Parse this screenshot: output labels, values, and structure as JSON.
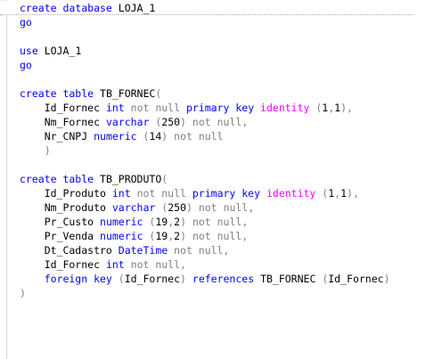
{
  "editor": {
    "lines": [
      [
        {
          "t": "create database ",
          "c": "kw"
        },
        {
          "t": "LOJA_1",
          "c": "tx"
        }
      ],
      [
        {
          "t": "go",
          "c": "kw"
        }
      ],
      [],
      [
        {
          "t": "use ",
          "c": "kw"
        },
        {
          "t": "LOJA_1",
          "c": "tx"
        }
      ],
      [
        {
          "t": "go",
          "c": "kw"
        }
      ],
      [],
      [
        {
          "t": "create table ",
          "c": "kw"
        },
        {
          "t": "TB_FORNEC",
          "c": "tx"
        },
        {
          "t": "(",
          "c": "gr"
        }
      ],
      [
        {
          "t": "    Id_Fornec ",
          "c": "tx"
        },
        {
          "t": "int ",
          "c": "kw"
        },
        {
          "t": "not null ",
          "c": "gr"
        },
        {
          "t": "primary key ",
          "c": "kw"
        },
        {
          "t": "identity ",
          "c": "pk"
        },
        {
          "t": "(",
          "c": "gr"
        },
        {
          "t": "1",
          "c": "tx"
        },
        {
          "t": ",",
          "c": "gr"
        },
        {
          "t": "1",
          "c": "tx"
        },
        {
          "t": "),",
          "c": "gr"
        }
      ],
      [
        {
          "t": "    Nm_Fornec ",
          "c": "tx"
        },
        {
          "t": "varchar ",
          "c": "kw"
        },
        {
          "t": "(",
          "c": "gr"
        },
        {
          "t": "250",
          "c": "tx"
        },
        {
          "t": ") ",
          "c": "gr"
        },
        {
          "t": "not null,",
          "c": "gr"
        }
      ],
      [
        {
          "t": "    Nr_CNPJ ",
          "c": "tx"
        },
        {
          "t": "numeric ",
          "c": "kw"
        },
        {
          "t": "(",
          "c": "gr"
        },
        {
          "t": "14",
          "c": "tx"
        },
        {
          "t": ") ",
          "c": "gr"
        },
        {
          "t": "not null",
          "c": "gr"
        }
      ],
      [
        {
          "t": "    )",
          "c": "gr"
        }
      ],
      [],
      [
        {
          "t": "create table ",
          "c": "kw"
        },
        {
          "t": "TB_PRODUTO",
          "c": "tx"
        },
        {
          "t": "(",
          "c": "gr"
        }
      ],
      [
        {
          "t": "    Id_Produto ",
          "c": "tx"
        },
        {
          "t": "int ",
          "c": "kw"
        },
        {
          "t": "not null ",
          "c": "gr"
        },
        {
          "t": "primary key ",
          "c": "kw"
        },
        {
          "t": "identity ",
          "c": "pk"
        },
        {
          "t": "(",
          "c": "gr"
        },
        {
          "t": "1",
          "c": "tx"
        },
        {
          "t": ",",
          "c": "gr"
        },
        {
          "t": "1",
          "c": "tx"
        },
        {
          "t": "),",
          "c": "gr"
        }
      ],
      [
        {
          "t": "    Nm_Produto ",
          "c": "tx"
        },
        {
          "t": "varchar ",
          "c": "kw"
        },
        {
          "t": "(",
          "c": "gr"
        },
        {
          "t": "250",
          "c": "tx"
        },
        {
          "t": ") ",
          "c": "gr"
        },
        {
          "t": "not null,",
          "c": "gr"
        }
      ],
      [
        {
          "t": "    Pr_Custo ",
          "c": "tx"
        },
        {
          "t": "numeric ",
          "c": "kw"
        },
        {
          "t": "(",
          "c": "gr"
        },
        {
          "t": "19",
          "c": "tx"
        },
        {
          "t": ",",
          "c": "gr"
        },
        {
          "t": "2",
          "c": "tx"
        },
        {
          "t": ") ",
          "c": "gr"
        },
        {
          "t": "not null,",
          "c": "gr"
        }
      ],
      [
        {
          "t": "    Pr_Venda ",
          "c": "tx"
        },
        {
          "t": "numeric ",
          "c": "kw"
        },
        {
          "t": "(",
          "c": "gr"
        },
        {
          "t": "19",
          "c": "tx"
        },
        {
          "t": ",",
          "c": "gr"
        },
        {
          "t": "2",
          "c": "tx"
        },
        {
          "t": ") ",
          "c": "gr"
        },
        {
          "t": "not null,",
          "c": "gr"
        }
      ],
      [
        {
          "t": "    Dt_Cadastro ",
          "c": "tx"
        },
        {
          "t": "DateTime ",
          "c": "kw"
        },
        {
          "t": "not null,",
          "c": "gr"
        }
      ],
      [
        {
          "t": "    Id_Fornec ",
          "c": "tx"
        },
        {
          "t": "int ",
          "c": "kw"
        },
        {
          "t": "not null,",
          "c": "gr"
        }
      ],
      [
        {
          "t": "    foreign key ",
          "c": "kw"
        },
        {
          "t": "(",
          "c": "gr"
        },
        {
          "t": "Id_Fornec",
          "c": "tx"
        },
        {
          "t": ") ",
          "c": "gr"
        },
        {
          "t": "references ",
          "c": "kw"
        },
        {
          "t": "TB_FORNEC ",
          "c": "tx"
        },
        {
          "t": "(",
          "c": "gr"
        },
        {
          "t": "Id_Fornec",
          "c": "tx"
        },
        {
          "t": ")",
          "c": "gr"
        }
      ],
      [
        {
          "t": ")",
          "c": "gr"
        }
      ]
    ]
  }
}
